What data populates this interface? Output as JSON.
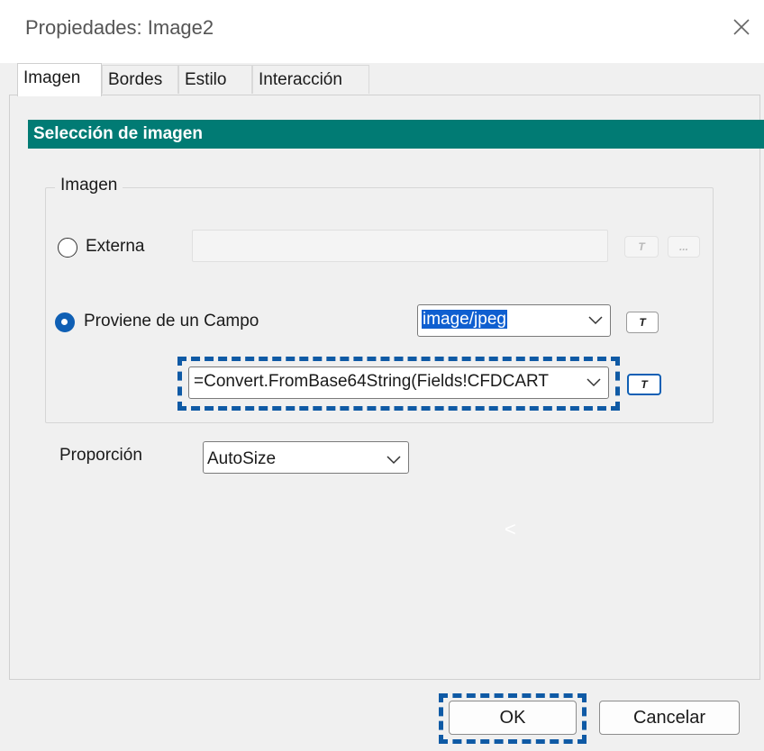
{
  "window": {
    "title": "Propiedades: Image2"
  },
  "tabs": [
    {
      "label": "Imagen",
      "active": true
    },
    {
      "label": "Bordes",
      "active": false
    },
    {
      "label": "Estilo",
      "active": false
    },
    {
      "label": "Interacción",
      "active": false
    }
  ],
  "section": {
    "header": "Selección de imagen"
  },
  "image_group": {
    "legend": "Imagen",
    "external": {
      "label": "Externa",
      "selected": false,
      "path_value": "",
      "expr_button": "T",
      "browse_button": "..."
    },
    "from_field": {
      "label": "Proviene de un Campo",
      "selected": true,
      "mime_value": "image/jpeg",
      "mime_expr_button": "T",
      "field_value": "=Convert.FromBase64String(Fields!CFDCART",
      "field_expr_button": "T"
    }
  },
  "proportion": {
    "label": "Proporción",
    "value": "AutoSize"
  },
  "hint_glyph": "<",
  "footer": {
    "ok_label": "OK",
    "cancel_label": "Cancelar"
  },
  "colors": {
    "section_header": "#017b74",
    "accent": "#0f5fb4",
    "focus_dash": "#0f5aa5"
  }
}
